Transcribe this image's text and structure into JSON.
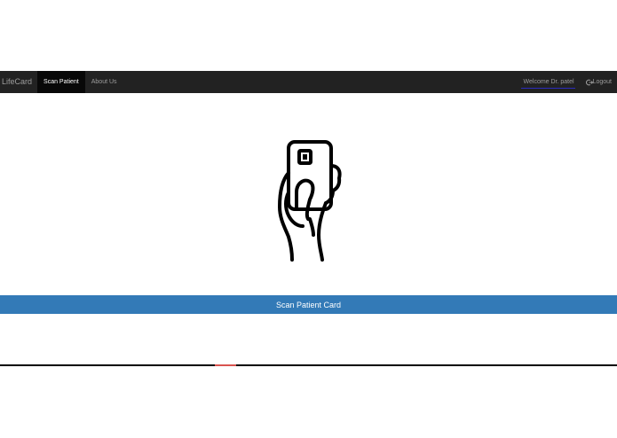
{
  "navbar": {
    "brand": "LifeCard",
    "items": [
      {
        "label": "Scan Patient",
        "active": true
      },
      {
        "label": "About Us",
        "active": false
      }
    ],
    "welcome": "Welcome Dr. patel",
    "logout_label": "Logout",
    "logout_icon": "logout-icon"
  },
  "main": {
    "illustration": "hand-holding-card-icon",
    "scan_button_label": "Scan Patient Card"
  },
  "colors": {
    "navbar_bg": "#222222",
    "active_tab_bg": "#080808",
    "button_bg": "#337ab7",
    "accent_line": "#d9534f"
  }
}
